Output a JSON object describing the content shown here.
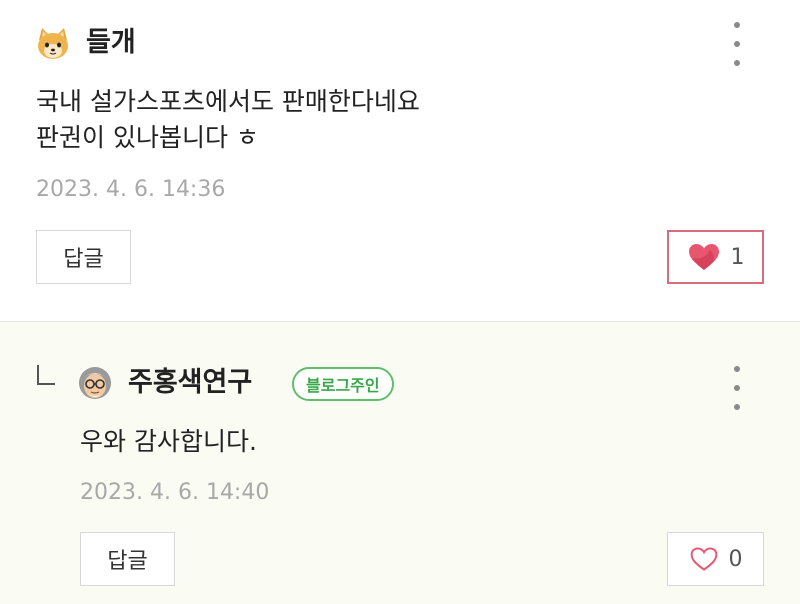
{
  "comments": [
    {
      "author": "들개",
      "avatar_icon": "cat-emoji-avatar",
      "text": "국내 설가스포츠에서도 판매한다네요\n판권이 있나봅니다 ㅎ",
      "date": "2023. 4. 6. 14:36",
      "reply_label": "답글",
      "like_count": "1",
      "liked": true
    },
    {
      "author": "주홍색연구",
      "avatar_icon": "grandpa-avatar",
      "badge": "블로그주인",
      "text": "우와 감사합니다.",
      "date": "2023. 4. 6. 14:40",
      "reply_label": "답글",
      "like_count": "0",
      "liked": false
    }
  ],
  "colors": {
    "heart_active": "#e8556e",
    "heart_outline": "#e8556e",
    "badge_green": "#3aa84a",
    "reply_background": "#fafcf4"
  }
}
